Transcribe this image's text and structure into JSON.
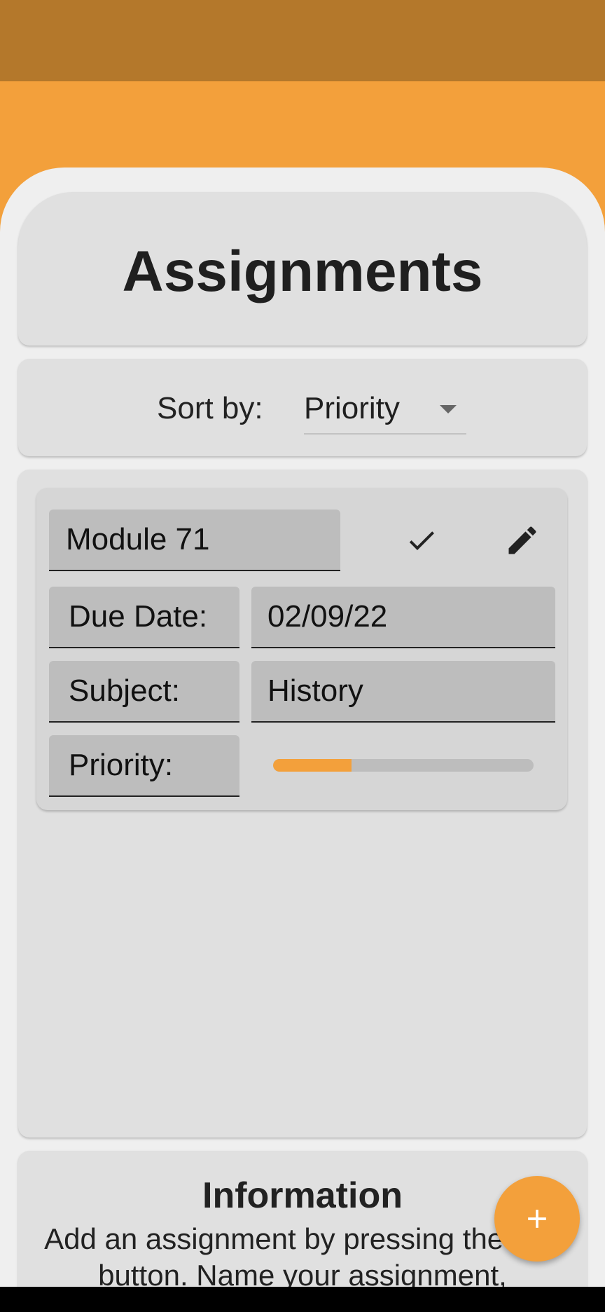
{
  "header": {
    "title": "Assignments"
  },
  "sort": {
    "label": "Sort by:",
    "selected": "Priority"
  },
  "assignment": {
    "name": "Module 71",
    "due_label": "Due Date:",
    "due_value": "02/09/22",
    "subject_label": "Subject:",
    "subject_value": "History",
    "priority_label": "Priority:",
    "priority_level": 0.3
  },
  "info": {
    "title": "Information",
    "text": "Add an assignment by pressing the add button. Name your assignment,"
  },
  "icons": {
    "check": "check-icon",
    "edit": "pencil-icon",
    "add": "plus-icon",
    "sort_dropdown": "chevron-down-icon"
  },
  "colors": {
    "accent": "#f3a03b",
    "status_bar": "#b4782b",
    "card": "#e0e0e0",
    "field": "#bdbdbd"
  }
}
